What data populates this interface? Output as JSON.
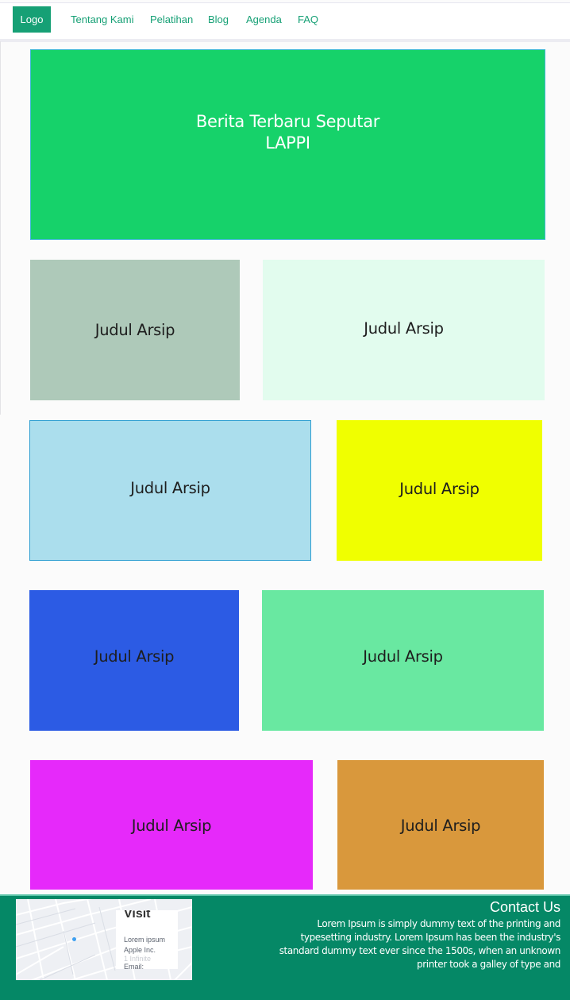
{
  "nav": {
    "logo": "Logo",
    "links": [
      "Tentang Kami",
      "Pelatihan",
      "Blog",
      "Agenda",
      "FAQ"
    ]
  },
  "hero": {
    "title_line1": "Berita Terbaru Seputar",
    "title_line2": "LAPPI",
    "color": "#16d26a"
  },
  "cards": [
    {
      "label": "Judul Arsip",
      "color": "#aec9b9"
    },
    {
      "label": "Judul Arsip",
      "color": "#e2fcee"
    },
    {
      "label": "Judul Arsip",
      "color": "#abdeed"
    },
    {
      "label": "Judul Arsip",
      "color": "#f0ff00"
    },
    {
      "label": "Judul Arsip",
      "color": "#2c5be4"
    },
    {
      "label": "Judul Arsip",
      "color": "#69e8a1"
    },
    {
      "label": "Judul Arsip",
      "color": "#e629fa"
    },
    {
      "label": "Judul Arsip",
      "color": "#d9983c"
    }
  ],
  "footer": {
    "map_card": {
      "title": "Visit",
      "line1": "Lorem ipsum",
      "line2": "Apple Inc.",
      "line3": "1 Infinite",
      "line4": "Email:"
    },
    "contact_title": "Contact Us",
    "contact_text": "Lorem Ipsum is simply dummy text of the printing and typesetting industry. Lorem Ipsum has been the industry's standard dummy text ever since the 1500s, when an unknown printer took a galley of type and",
    "color": "#058866"
  }
}
